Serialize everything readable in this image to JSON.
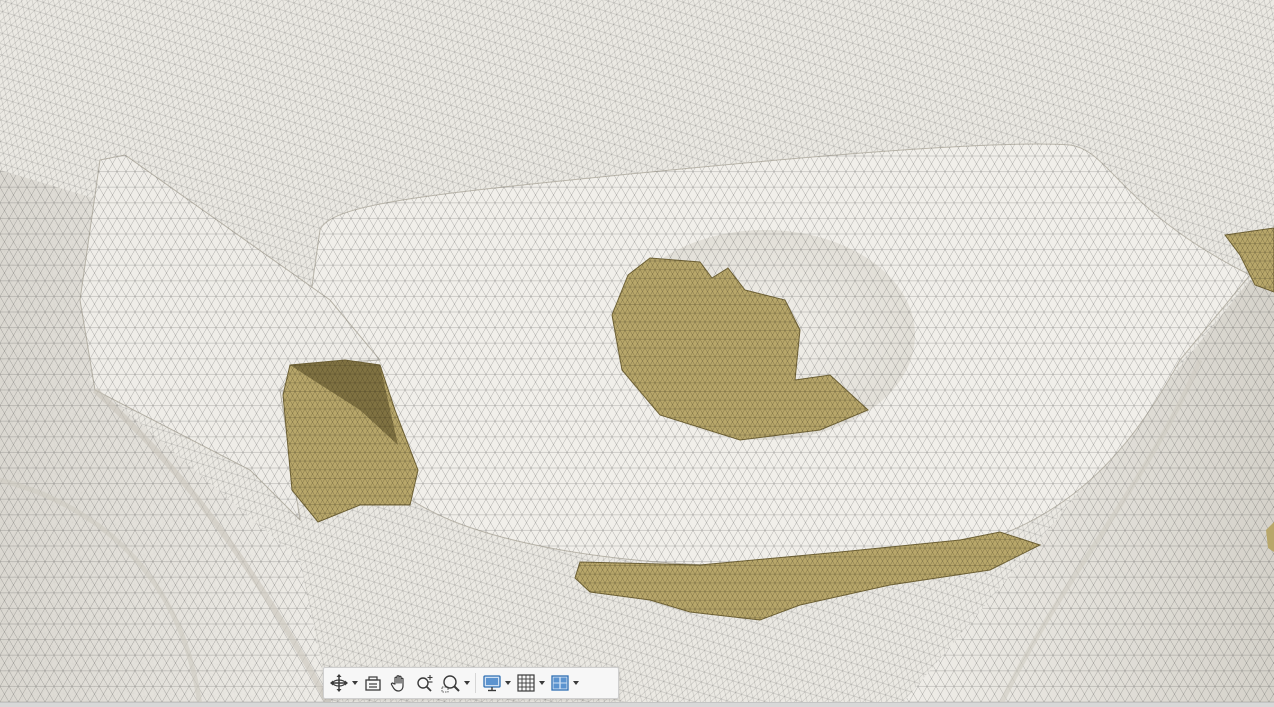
{
  "viewport": {
    "name": "3d-mesh-viewport",
    "mesh_color": "#edebe5",
    "mesh_shadow_color": "#d7d4cc",
    "edge_color": "#3c3c3c",
    "interior_color": "#b8a76a",
    "interior_dark_color": "#6f6236",
    "background_color": "#e9e7e1"
  },
  "toolbar": {
    "buttons": [
      {
        "name": "orbit-button",
        "icon": "orbit-icon",
        "has_dropdown": true
      },
      {
        "name": "look-at-button",
        "icon": "look-at-icon",
        "has_dropdown": false
      },
      {
        "name": "pan-button",
        "icon": "pan-hand-icon",
        "has_dropdown": false
      },
      {
        "name": "zoom-button",
        "icon": "zoom-plus-minus-icon",
        "has_dropdown": false
      },
      {
        "name": "fit-button",
        "icon": "zoom-window-icon",
        "has_dropdown": true
      },
      {
        "name": "display-settings-button",
        "icon": "display-monitor-icon",
        "has_dropdown": true
      },
      {
        "name": "grid-snaps-button",
        "icon": "grid-icon",
        "has_dropdown": true
      },
      {
        "name": "viewports-button",
        "icon": "multi-viewport-icon",
        "has_dropdown": true
      }
    ],
    "icon_color": "#3a3a3a",
    "accent_color": "#2f6fb3"
  }
}
